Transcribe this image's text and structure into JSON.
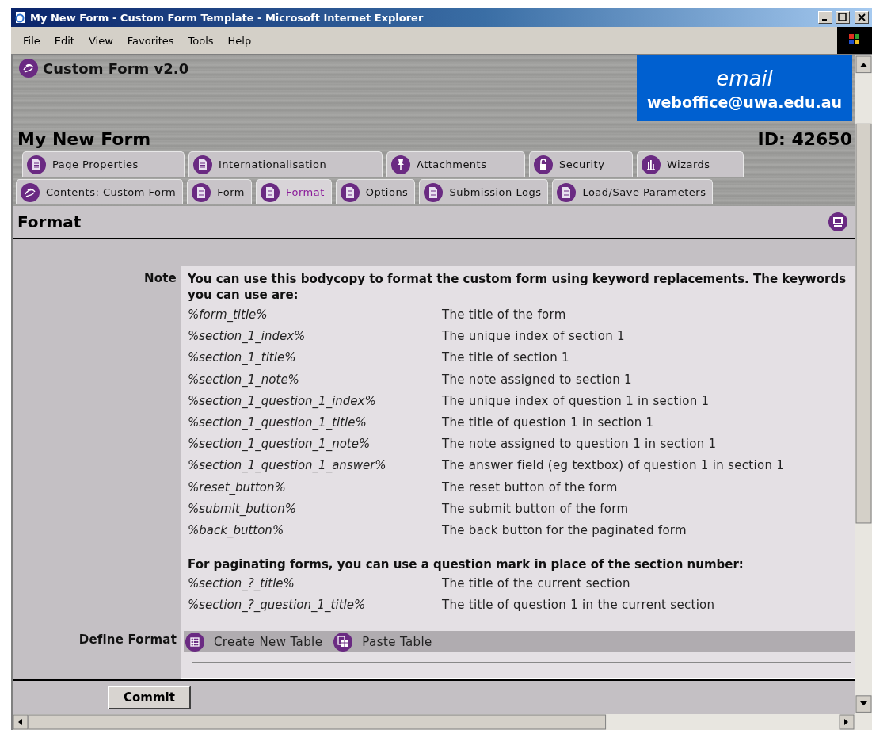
{
  "window": {
    "title": "My New Form - Custom Form Template - Microsoft Internet Explorer"
  },
  "menu": [
    {
      "label": "File"
    },
    {
      "label": "Edit"
    },
    {
      "label": "View"
    },
    {
      "label": "Favorites"
    },
    {
      "label": "Tools"
    },
    {
      "label": "Help"
    }
  ],
  "header": {
    "app_title": "Custom Form v2.0",
    "email_label": "email",
    "email_address": "weboffice@uwa.edu.au",
    "page_title": "My New Form",
    "id_label": "ID: 42650"
  },
  "tab_rows": [
    {
      "tabs": [
        {
          "label": "Page Properties",
          "kind": "page",
          "selected": false
        },
        {
          "label": "Internationalisation",
          "kind": "page",
          "selected": false
        },
        {
          "label": "Attachments",
          "kind": "pin",
          "selected": false
        },
        {
          "label": "Security",
          "kind": "lock",
          "selected": false
        },
        {
          "label": "Wizards",
          "kind": "chart",
          "selected": false
        }
      ]
    },
    {
      "tabs": [
        {
          "label": "Contents: Custom Form",
          "kind": "logo",
          "selected": false
        },
        {
          "label": "Form",
          "kind": "page",
          "selected": false
        },
        {
          "label": "Format",
          "kind": "page",
          "selected": true
        },
        {
          "label": "Options",
          "kind": "page",
          "selected": false
        },
        {
          "label": "Submission Logs",
          "kind": "page",
          "selected": false
        },
        {
          "label": "Load/Save Parameters",
          "kind": "page",
          "selected": false
        }
      ]
    }
  ],
  "section_title": "Format",
  "note": {
    "label": "Note",
    "intro": "You can use this bodycopy to format the custom form using keyword replacements. The keywords you can use are:",
    "keywords": [
      {
        "key": "%form_title%",
        "description": "The title of the form"
      },
      {
        "key": "%section_1_index%",
        "description": "The unique index of section 1"
      },
      {
        "key": "%section_1_title%",
        "description": "The title of section 1"
      },
      {
        "key": "%section_1_note%",
        "description": "The note assigned to section 1"
      },
      {
        "key": "%section_1_question_1_index%",
        "description": "The unique index of question 1 in section 1"
      },
      {
        "key": "%section_1_question_1_title%",
        "description": "The title of question 1 in section 1"
      },
      {
        "key": "%section_1_question_1_note%",
        "description": "The note assigned to question 1 in section 1"
      },
      {
        "key": "%section_1_question_1_answer%",
        "description": "The answer field (eg textbox) of question 1 in section 1"
      },
      {
        "key": "%reset_button%",
        "description": "The reset button of the form"
      },
      {
        "key": "%submit_button%",
        "description": "The submit button of the form"
      },
      {
        "key": "%back_button%",
        "description": "The back button for the paginated form"
      }
    ],
    "paginate_intro": "For paginating forms, you can use a question mark in place of the section number:",
    "paginate_keywords": [
      {
        "key": "%section_?_title%",
        "description": "The title of the current section"
      },
      {
        "key": "%section_?_question_1_title%",
        "description": "The title of question 1 in the current section"
      }
    ]
  },
  "define_format": {
    "label": "Define Format",
    "actions": [
      {
        "label": "Create New Table",
        "kind": "table"
      },
      {
        "label": "Paste Table",
        "kind": "paste"
      }
    ]
  },
  "commit_button": "Commit"
}
